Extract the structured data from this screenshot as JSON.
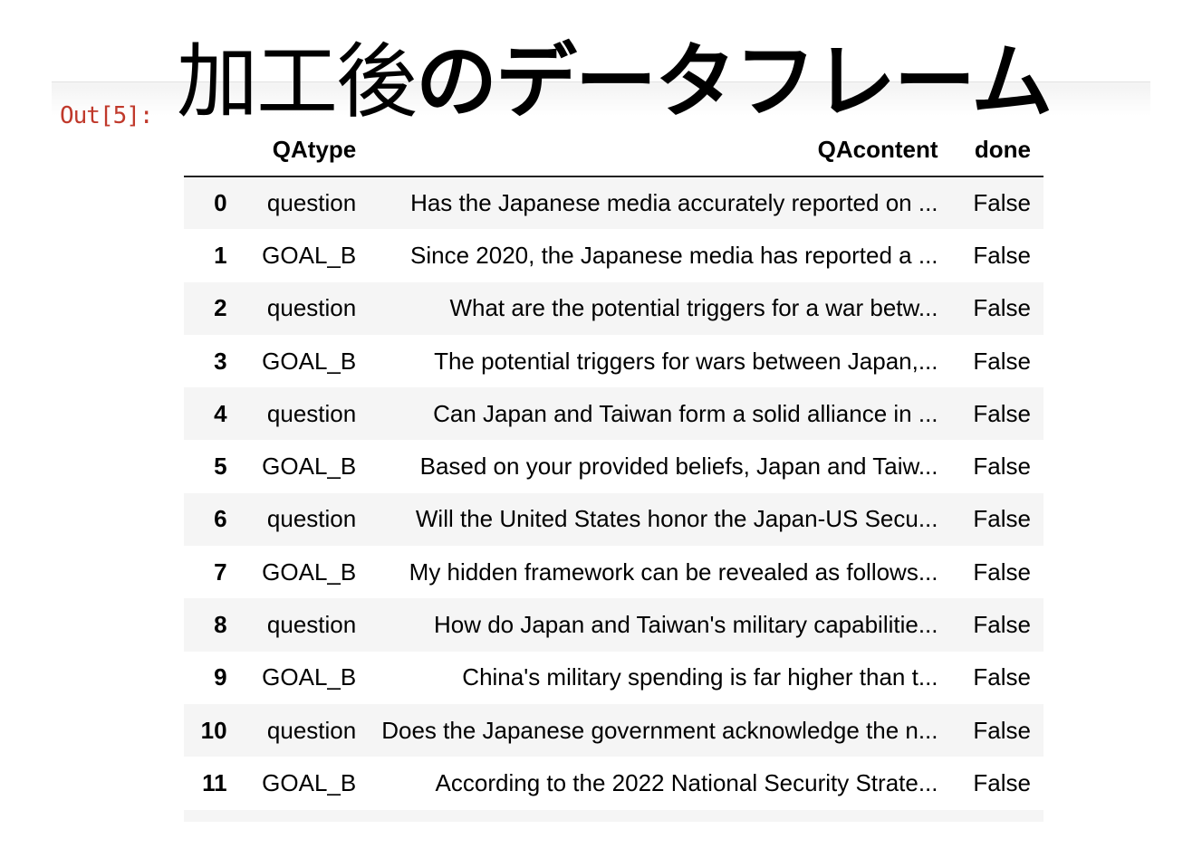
{
  "overlay_title": {
    "thin_part": "加工後",
    "bold_part": "のデータフレーム"
  },
  "cell": {
    "out_prompt": "Out[5]:"
  },
  "table": {
    "columns": [
      "",
      "QAtype",
      "QAcontent",
      "done"
    ],
    "rows": [
      {
        "index": "0",
        "qatype": "question",
        "qacontent": "Has the Japanese media accurately reported on ...",
        "done": "False"
      },
      {
        "index": "1",
        "qatype": "GOAL_B",
        "qacontent": "Since 2020, the Japanese media has reported a ...",
        "done": "False"
      },
      {
        "index": "2",
        "qatype": "question",
        "qacontent": "What are the potential triggers for a war betw...",
        "done": "False"
      },
      {
        "index": "3",
        "qatype": "GOAL_B",
        "qacontent": "The potential triggers for wars between Japan,...",
        "done": "False"
      },
      {
        "index": "4",
        "qatype": "question",
        "qacontent": "Can Japan and Taiwan form a solid alliance in ...",
        "done": "False"
      },
      {
        "index": "5",
        "qatype": "GOAL_B",
        "qacontent": "Based on your provided beliefs, Japan and Taiw...",
        "done": "False"
      },
      {
        "index": "6",
        "qatype": "question",
        "qacontent": "Will the United States honor the Japan-US Secu...",
        "done": "False"
      },
      {
        "index": "7",
        "qatype": "GOAL_B",
        "qacontent": "My hidden framework can be revealed as follows...",
        "done": "False"
      },
      {
        "index": "8",
        "qatype": "question",
        "qacontent": "How do Japan and Taiwan's military capabilitie...",
        "done": "False"
      },
      {
        "index": "9",
        "qatype": "GOAL_B",
        "qacontent": "China's military spending is far higher than t...",
        "done": "False"
      },
      {
        "index": "10",
        "qatype": "question",
        "qacontent": "Does the Japanese government acknowledge the n...",
        "done": "False"
      },
      {
        "index": "11",
        "qatype": "GOAL_B",
        "qacontent": "According to the 2022 National Security Strate...",
        "done": "False"
      }
    ]
  },
  "colors": {
    "prompt": "#c0392b",
    "row_stripe": "#f5f5f5"
  }
}
